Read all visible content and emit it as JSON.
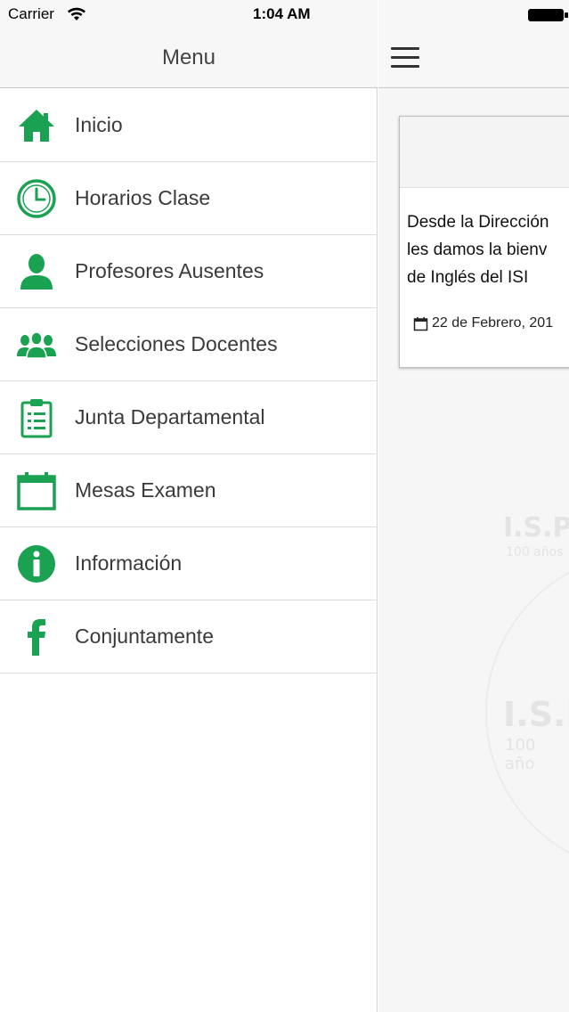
{
  "status_bar": {
    "carrier": "Carrier",
    "time": "1:04 AM"
  },
  "menu": {
    "title": "Menu",
    "accent_color": "#1aa152",
    "items": [
      {
        "label": "Inicio",
        "icon": "home-icon"
      },
      {
        "label": "Horarios Clase",
        "icon": "clock-icon"
      },
      {
        "label": "Profesores Ausentes",
        "icon": "person-icon"
      },
      {
        "label": "Selecciones Docentes",
        "icon": "group-icon"
      },
      {
        "label": "Junta Departamental",
        "icon": "clipboard-icon"
      },
      {
        "label": "Mesas Examen",
        "icon": "calendar-icon"
      },
      {
        "label": "Información",
        "icon": "info-icon"
      },
      {
        "label": "Conjuntamente",
        "icon": "facebook-icon"
      }
    ]
  },
  "content": {
    "news": {
      "line1": "Desde la Dirección",
      "line2": "les damos la bienv",
      "line3": "de  Inglés  del  ISI",
      "date": "22 de Febrero, 201"
    },
    "watermark": {
      "text1": "I.S.P",
      "text2": "100 años",
      "text3": "I.S.F",
      "text4": "100 año"
    }
  }
}
